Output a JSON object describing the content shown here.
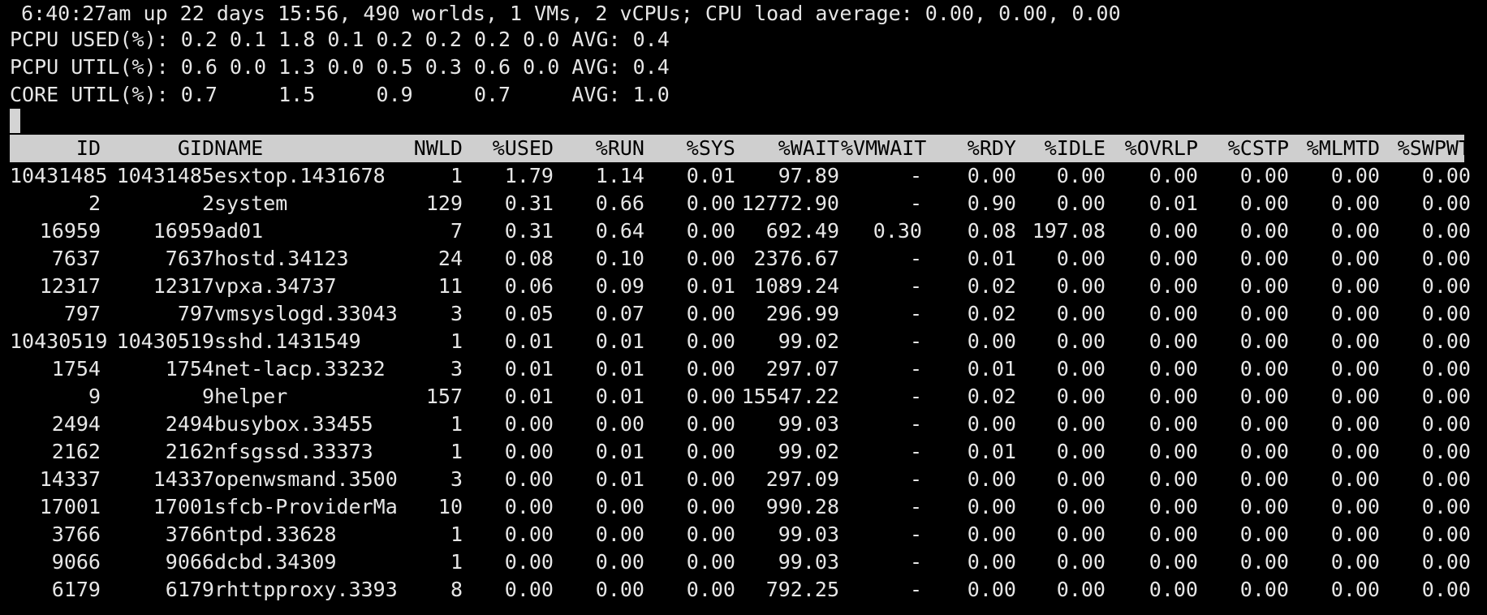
{
  "header": {
    "line1": "6:40:27am up 22 days 15:56, 490 worlds, 1 VMs, 2 vCPUs; CPU load average: 0.00, 0.00, 0.00",
    "line2": "PCPU USED(%): 0.2 0.1 1.8 0.1 0.2 0.2 0.2 0.0 AVG: 0.4",
    "line3": "PCPU UTIL(%): 0.6 0.0 1.3 0.0 0.5 0.3 0.6 0.0 AVG: 0.4",
    "line4": "CORE UTIL(%): 0.7     1.5     0.9     0.7     AVG: 1.0"
  },
  "columns": [
    "ID",
    "GID",
    "NAME",
    "NWLD",
    "%USED",
    "%RUN",
    "%SYS",
    "%WAIT",
    "%VMWAIT",
    "%RDY",
    "%IDLE",
    "%OVRLP",
    "%CSTP",
    "%MLMTD",
    "%SWPWT"
  ],
  "rows": [
    [
      "10431485",
      "10431485",
      "esxtop.1431678",
      "1",
      "1.79",
      "1.14",
      "0.01",
      "97.89",
      "-",
      "0.00",
      "0.00",
      "0.00",
      "0.00",
      "0.00",
      "0.00"
    ],
    [
      "2",
      "2",
      "system",
      "129",
      "0.31",
      "0.66",
      "0.00",
      "12772.90",
      "-",
      "0.90",
      "0.00",
      "0.01",
      "0.00",
      "0.00",
      "0.00"
    ],
    [
      "16959",
      "16959",
      "ad01",
      "7",
      "0.31",
      "0.64",
      "0.00",
      "692.49",
      "0.30",
      "0.08",
      "197.08",
      "0.00",
      "0.00",
      "0.00",
      "0.00"
    ],
    [
      "7637",
      "7637",
      "hostd.34123",
      "24",
      "0.08",
      "0.10",
      "0.00",
      "2376.67",
      "-",
      "0.01",
      "0.00",
      "0.00",
      "0.00",
      "0.00",
      "0.00"
    ],
    [
      "12317",
      "12317",
      "vpxa.34737",
      "11",
      "0.06",
      "0.09",
      "0.01",
      "1089.24",
      "-",
      "0.02",
      "0.00",
      "0.00",
      "0.00",
      "0.00",
      "0.00"
    ],
    [
      "797",
      "797",
      "vmsyslogd.33043",
      "3",
      "0.05",
      "0.07",
      "0.00",
      "296.99",
      "-",
      "0.02",
      "0.00",
      "0.00",
      "0.00",
      "0.00",
      "0.00"
    ],
    [
      "10430519",
      "10430519",
      "sshd.1431549",
      "1",
      "0.01",
      "0.01",
      "0.00",
      "99.02",
      "-",
      "0.00",
      "0.00",
      "0.00",
      "0.00",
      "0.00",
      "0.00"
    ],
    [
      "1754",
      "1754",
      "net-lacp.33232",
      "3",
      "0.01",
      "0.01",
      "0.00",
      "297.07",
      "-",
      "0.01",
      "0.00",
      "0.00",
      "0.00",
      "0.00",
      "0.00"
    ],
    [
      "9",
      "9",
      "helper",
      "157",
      "0.01",
      "0.01",
      "0.00",
      "15547.22",
      "-",
      "0.02",
      "0.00",
      "0.00",
      "0.00",
      "0.00",
      "0.00"
    ],
    [
      "2494",
      "2494",
      "busybox.33455",
      "1",
      "0.00",
      "0.00",
      "0.00",
      "99.03",
      "-",
      "0.00",
      "0.00",
      "0.00",
      "0.00",
      "0.00",
      "0.00"
    ],
    [
      "2162",
      "2162",
      "nfsgssd.33373",
      "1",
      "0.00",
      "0.01",
      "0.00",
      "99.02",
      "-",
      "0.01",
      "0.00",
      "0.00",
      "0.00",
      "0.00",
      "0.00"
    ],
    [
      "14337",
      "14337",
      "openwsmand.3500",
      "3",
      "0.00",
      "0.01",
      "0.00",
      "297.09",
      "-",
      "0.00",
      "0.00",
      "0.00",
      "0.00",
      "0.00",
      "0.00"
    ],
    [
      "17001",
      "17001",
      "sfcb-ProviderMa",
      "10",
      "0.00",
      "0.00",
      "0.00",
      "990.28",
      "-",
      "0.00",
      "0.00",
      "0.00",
      "0.00",
      "0.00",
      "0.00"
    ],
    [
      "3766",
      "3766",
      "ntpd.33628",
      "1",
      "0.00",
      "0.00",
      "0.00",
      "99.03",
      "-",
      "0.00",
      "0.00",
      "0.00",
      "0.00",
      "0.00",
      "0.00"
    ],
    [
      "9066",
      "9066",
      "dcbd.34309",
      "1",
      "0.00",
      "0.00",
      "0.00",
      "99.03",
      "-",
      "0.00",
      "0.00",
      "0.00",
      "0.00",
      "0.00",
      "0.00"
    ],
    [
      "6179",
      "6179",
      "rhttpproxy.3393",
      "8",
      "0.00",
      "0.00",
      "0.00",
      "792.25",
      "-",
      "0.00",
      "0.00",
      "0.00",
      "0.00",
      "0.00",
      "0.00"
    ]
  ],
  "colors": {
    "background": "#000000",
    "text": "#e6e6e6",
    "header_bar": "#cfcfcf",
    "header_text": "#000000",
    "cursor": "#d4d4d4"
  }
}
